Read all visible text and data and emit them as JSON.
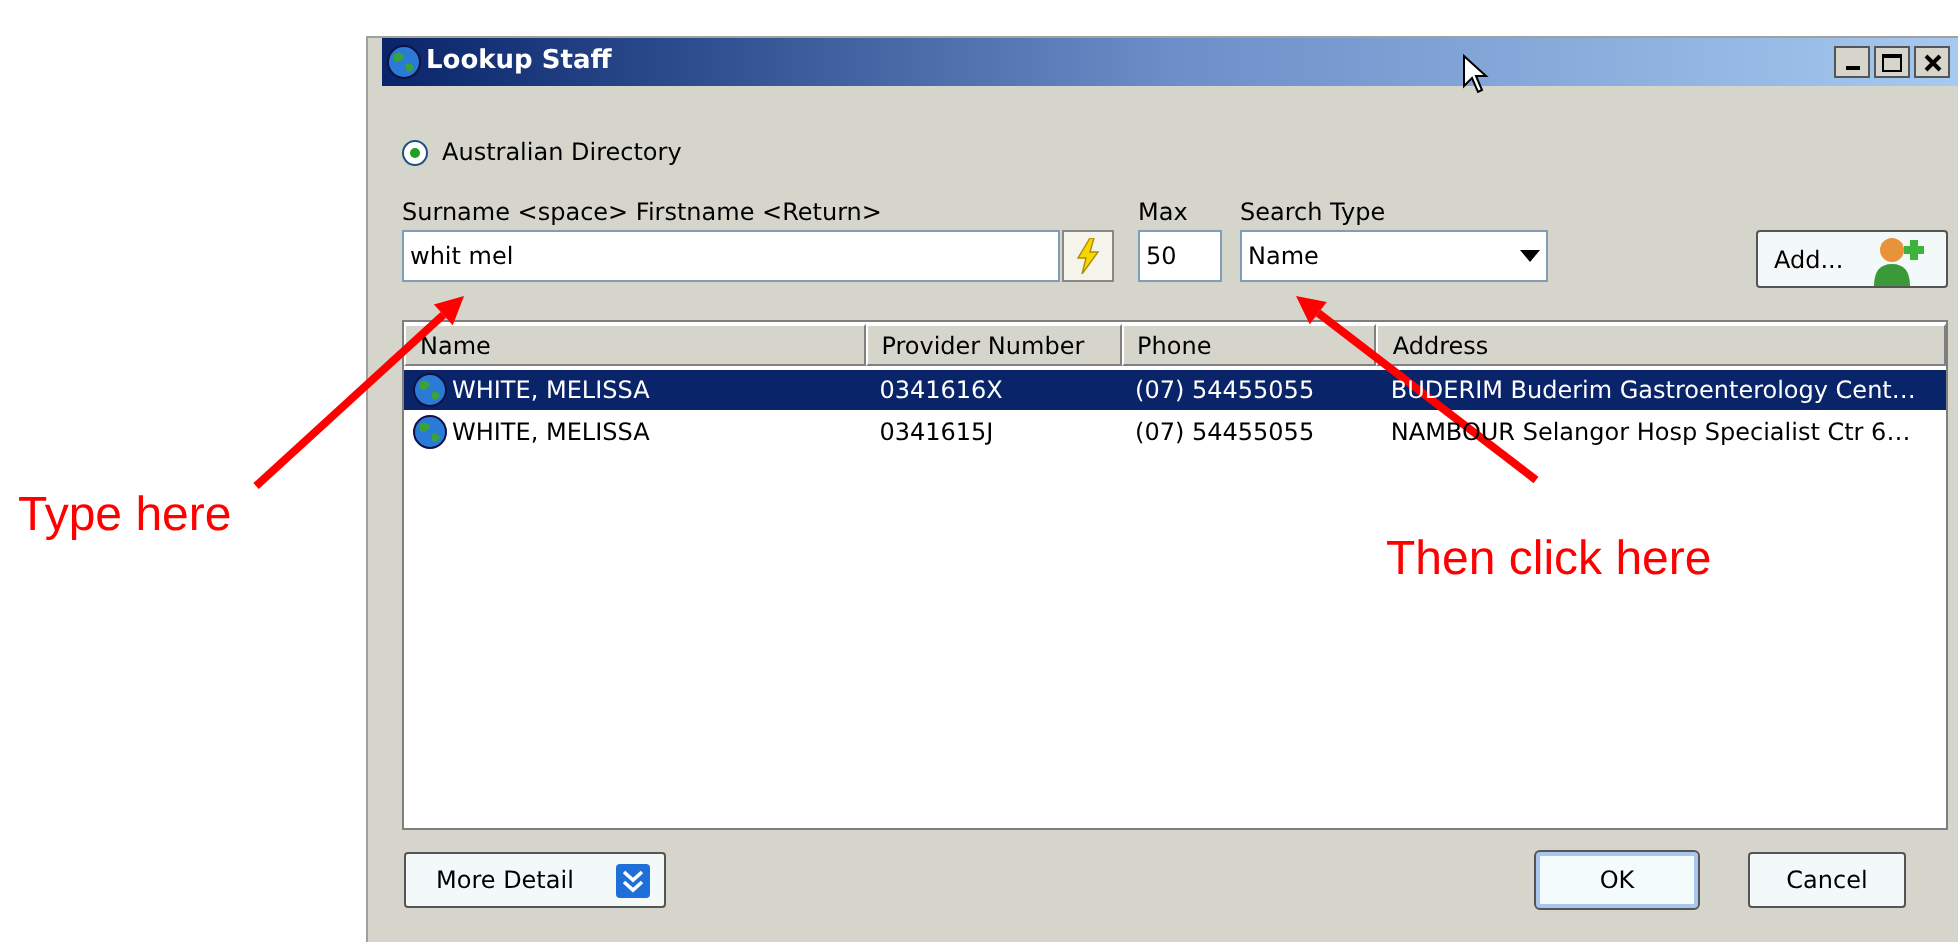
{
  "window": {
    "title": "Lookup Staff"
  },
  "directory_option": {
    "label": "Australian Directory",
    "selected": true
  },
  "surname_field": {
    "label": "Surname <space> Firstname <Return>",
    "value": "whit mel"
  },
  "max_field": {
    "label": "Max",
    "value": "50"
  },
  "search_type": {
    "label": "Search Type",
    "value": "Name"
  },
  "add_button": {
    "label": "Add..."
  },
  "table": {
    "columns": [
      "Name",
      "Provider Number",
      "Phone",
      "Address"
    ],
    "rows": [
      {
        "cells": [
          "WHITE, MELISSA",
          "0341616X",
          "(07) 54455055",
          "BUDERIM Buderim Gastroenterology Cent…"
        ],
        "selected": true
      },
      {
        "cells": [
          "WHITE, MELISSA",
          "0341615J",
          "(07) 54455055",
          "NAMBOUR Selangor Hosp Specialist Ctr 6…"
        ],
        "selected": false
      }
    ]
  },
  "buttons": {
    "more_detail": "More Detail",
    "ok": "OK",
    "cancel": "Cancel"
  },
  "annotations": [
    {
      "text": "Type here"
    },
    {
      "text": "Then click here"
    }
  ]
}
